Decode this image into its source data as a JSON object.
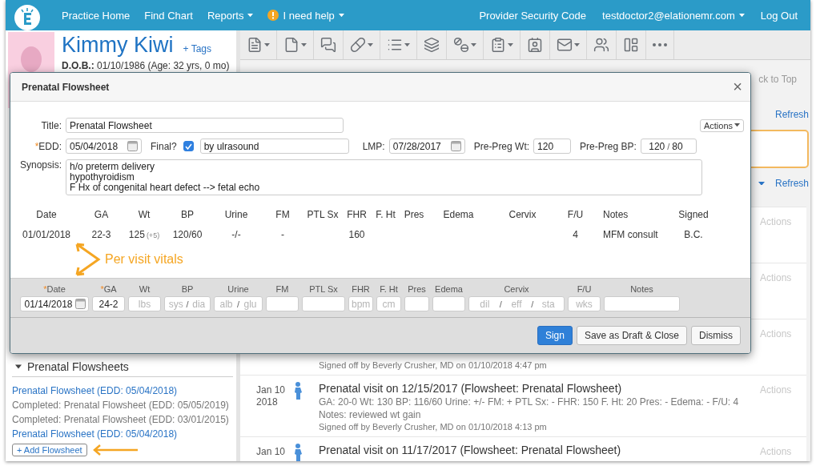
{
  "nav": {
    "items": [
      {
        "label": "Practice Home",
        "dropdown": false,
        "alert": false
      },
      {
        "label": "Find Chart",
        "dropdown": false,
        "alert": false
      },
      {
        "label": "Reports",
        "dropdown": true,
        "alert": false
      },
      {
        "label": "I need help",
        "dropdown": true,
        "alert": true
      }
    ],
    "right_items": [
      {
        "label": "Provider Security Code",
        "dropdown": false
      },
      {
        "label": "testdoctor2@elationemr.com",
        "dropdown": true
      },
      {
        "label": "Log Out",
        "dropdown": false
      }
    ]
  },
  "patient": {
    "name": "Kimmy Kiwi",
    "tags_link": "+ Tags",
    "dob_label": "D.O.B.:",
    "dob": "01/10/1986 (Age: 32 yrs, 0 mo)"
  },
  "toolbar": [
    {
      "dropdown": true
    },
    {
      "dropdown": true
    },
    {
      "dropdown": false
    },
    {
      "dropdown": true
    },
    {
      "dropdown": true
    },
    {
      "dropdown": false
    },
    {
      "dropdown": true
    },
    {
      "dropdown": true
    },
    {
      "dropdown": false
    },
    {
      "dropdown": true
    },
    {
      "dropdown": false
    },
    {
      "dropdown": false
    },
    {
      "dropdown": false
    }
  ],
  "back_to_top": "ck to Top",
  "side_panel": {
    "refresh_links": [
      "Refresh",
      "Refresh"
    ]
  },
  "timeline": [
    {
      "actions": "Actions"
    },
    {
      "actions": "Actions"
    },
    {
      "signed": "Signed off by Beverly Crusher, MD on 01/10/2018 4:47 pm",
      "actions": "Actions"
    },
    {
      "date": "Jan 10",
      "year": "2018",
      "title": "Prenatal visit on 12/15/2017 (Flowsheet: Prenatal Flowsheet)",
      "details": "GA: 20-0 Wt: 130 BP: 116/60 Urine: +/- FM: + PTL Sx: - FHR: 150 F. Ht: 20 Pres: - Edema: - F/U: 4",
      "notes": "Notes: reviewed wt gain",
      "signed": "Signed off by Beverly Crusher, MD on 01/10/2018 4:13 pm",
      "actions": "Actions"
    },
    {
      "date": "Jan 10",
      "title": "Prenatal visit on 11/17/2017 (Flowsheet: Prenatal Flowsheet)",
      "actions": "Actions"
    }
  ],
  "flowsheets_section": {
    "title": "Prenatal Flowsheets",
    "expanded": true,
    "items": [
      {
        "label": "Prenatal Flowsheet (EDD: 05/04/2018)",
        "completed": false
      },
      {
        "label": "Completed: Prenatal Flowsheet (EDD: 05/05/2019)",
        "completed": true
      },
      {
        "label": "Completed: Prenatal Flowsheet (EDD: 03/01/2015)",
        "completed": true
      },
      {
        "label": "Prenatal Flowsheet (EDD: 05/04/2018)",
        "completed": false
      }
    ],
    "add_button": "+ Add Flowsheet"
  },
  "modal": {
    "title": "Prenatal Flowsheet",
    "close": "×",
    "actions_button": "Actions",
    "required_mark": "*",
    "fields": {
      "title_label": "Title:",
      "title_value": "Prenatal Flowsheet",
      "edd_label": "EDD:",
      "edd_required": true,
      "edd_value": "05/04/2018",
      "final_label": "Final?",
      "final_checked": true,
      "final_note": "by ulrasound",
      "lmp_label": "LMP:",
      "lmp_value": "07/28/2017",
      "pre_wt_label": "Pre-Preg Wt:",
      "pre_wt_value": "120",
      "pre_bp_label": "Pre-Preg BP:",
      "pre_bp_values": [
        "120",
        "80"
      ],
      "pre_bp_separator": "/",
      "synopsis_label": "Synopsis:",
      "synopsis_lines": [
        "h/o preterm delivery",
        "hypothyroidism",
        "F Hx of congenital heart defect --> fetal echo"
      ]
    },
    "table": {
      "columns": [
        "Date",
        "GA",
        "Wt",
        "BP",
        "Urine",
        "FM",
        "PTL Sx",
        "FHR",
        "F. Ht",
        "Pres",
        "Edema",
        "Cervix",
        "F/U",
        "Notes",
        "Signed"
      ],
      "rows": [
        {
          "cells": [
            {
              "text": "01/01/2018"
            },
            {
              "text": "22-3"
            },
            {
              "text": "125",
              "note": "(+5)"
            },
            {
              "text": "120/60"
            },
            {
              "text": "-/-"
            },
            {
              "text": "-"
            },
            {},
            {
              "text": "160"
            },
            {},
            {},
            {},
            {},
            {
              "text": "4"
            },
            {
              "text": "MFM consult"
            },
            {
              "text": "B.C."
            }
          ]
        }
      ]
    },
    "annotation": "Per visit vitals",
    "entry_fields": [
      {
        "label": "Date",
        "required": true,
        "kind": "date",
        "value": "01/14/2018"
      },
      {
        "label": "GA",
        "required": true,
        "kind": "text",
        "value": "24-2"
      },
      {
        "label": "Wt",
        "required": false,
        "kind": "text",
        "placeholder": "lbs"
      },
      {
        "label": "BP",
        "required": false,
        "kind": "split",
        "placeholders": [
          "sys",
          "dia"
        ],
        "separator": "/"
      },
      {
        "label": "Urine",
        "required": false,
        "kind": "split",
        "placeholders": [
          "alb",
          "glu"
        ],
        "separator": "/"
      },
      {
        "label": "FM",
        "required": false,
        "kind": "text"
      },
      {
        "label": "PTL Sx",
        "required": false,
        "kind": "text"
      },
      {
        "label": "FHR",
        "required": false,
        "kind": "text",
        "placeholder": "bpm"
      },
      {
        "label": "F. Ht",
        "required": false,
        "kind": "text",
        "placeholder": "cm"
      },
      {
        "label": "Pres",
        "required": false,
        "kind": "text"
      },
      {
        "label": "Edema",
        "required": false,
        "kind": "text"
      },
      {
        "label": "Cervix",
        "required": false,
        "kind": "split",
        "placeholders": [
          "dil",
          "eff",
          "sta"
        ],
        "separator": "/"
      },
      {
        "label": "F/U",
        "required": false,
        "kind": "text",
        "placeholder": "wks"
      },
      {
        "label": "Notes",
        "required": false,
        "kind": "text"
      }
    ],
    "buttons": [
      {
        "label": "Sign",
        "primary": true
      },
      {
        "label": "Save as Draft & Close",
        "primary": false
      },
      {
        "label": "Dismiss",
        "primary": false
      }
    ]
  }
}
